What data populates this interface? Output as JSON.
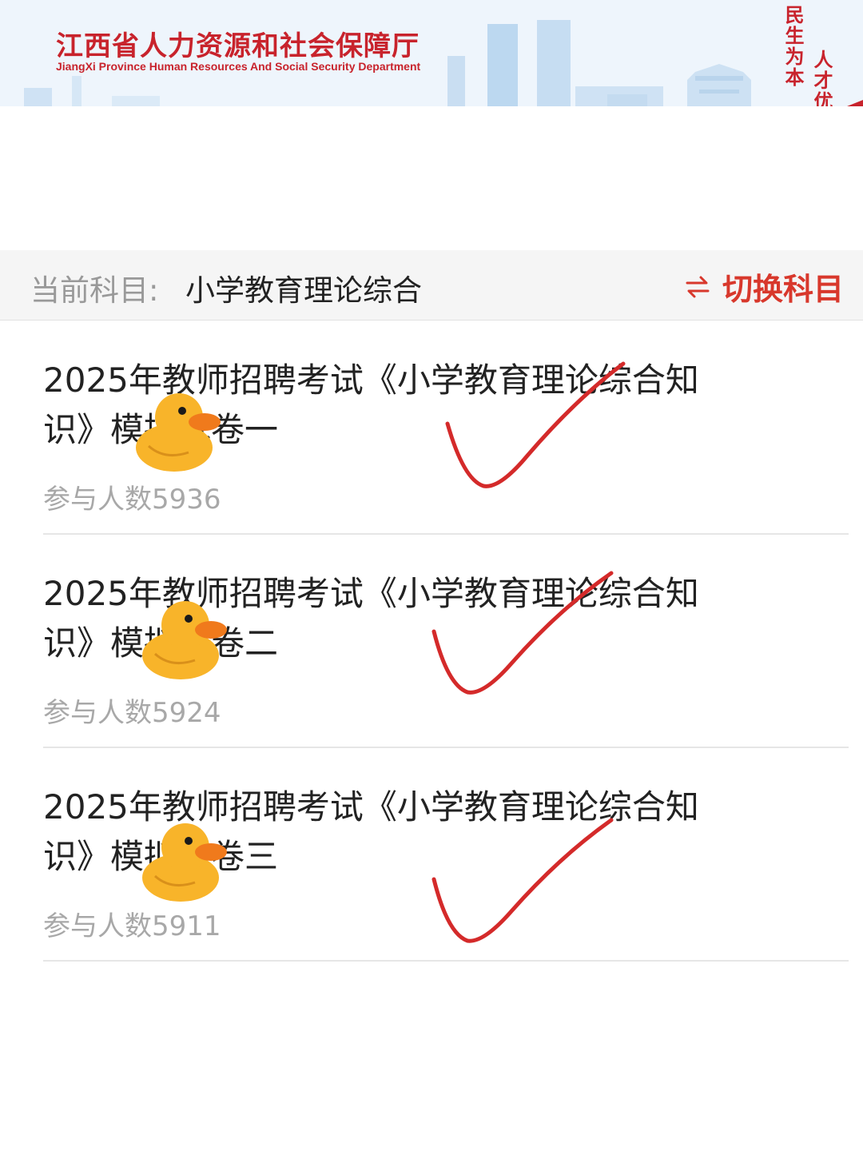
{
  "banner": {
    "title": "江西省人力资源和社会保障厅",
    "subtitle": "JiangXi Province Human Resources And Social Security Department",
    "calligraphy_col1": "民生为本",
    "calligraphy_col2": "人才优"
  },
  "subject_bar": {
    "label": "当前科目:",
    "value": "小学教育理论综合",
    "switch_label": "切换科目",
    "switch_icon": "swap-arrows-icon"
  },
  "exams": [
    {
      "title": "2025年教师招聘考试《小学教育理论综合知识》模拟试卷一",
      "count": "参与人数5936"
    },
    {
      "title": "2025年教师招聘考试《小学教育理论综合知识》模拟试卷二",
      "count": "参与人数5924"
    },
    {
      "title": "2025年教师招聘考试《小学教育理论综合知识》模拟试卷三",
      "count": "参与人数5911"
    }
  ],
  "colors": {
    "brand_red": "#c8232c",
    "accent_red": "#d8382c",
    "check_red": "#d42a2a",
    "duck_yellow": "#f8b42a",
    "duck_beak": "#f07a1c"
  },
  "stickers": {
    "duck_icon": "rubber-duck-icon",
    "check_icon": "red-check-icon"
  }
}
